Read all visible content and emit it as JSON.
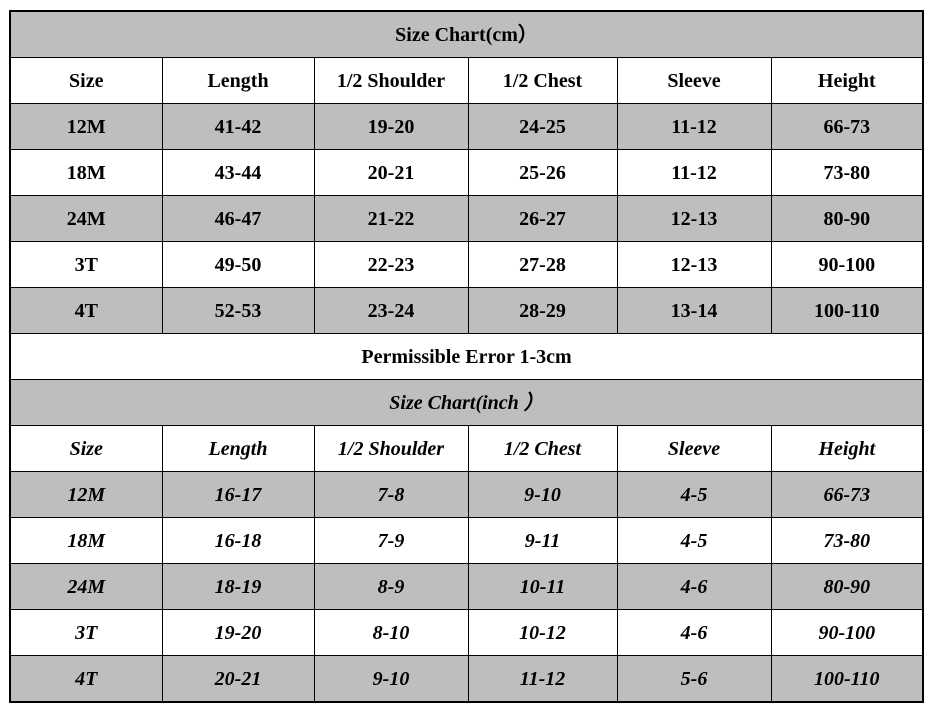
{
  "chart_data": {
    "type": "table",
    "title": "Size Chart",
    "sections": [
      {
        "id": "cm",
        "title": "Size Chart(cm）",
        "unit": "cm",
        "italic": false,
        "columns": [
          "Size",
          "Length",
          "1/2 Shoulder",
          "1/2 Chest",
          "Sleeve",
          "Height"
        ],
        "rows": [
          [
            "12M",
            "41-42",
            "19-20",
            "24-25",
            "11-12",
            "66-73"
          ],
          [
            "18M",
            "43-44",
            "20-21",
            "25-26",
            "11-12",
            "73-80"
          ],
          [
            "24M",
            "46-47",
            "21-22",
            "26-27",
            "12-13",
            "80-90"
          ],
          [
            "3T",
            "49-50",
            "22-23",
            "27-28",
            "12-13",
            "90-100"
          ],
          [
            "4T",
            "52-53",
            "23-24",
            "28-29",
            "13-14",
            "100-110"
          ]
        ]
      },
      {
        "id": "inch",
        "title": "Size Chart(inch ）",
        "unit": "inch",
        "italic": true,
        "columns": [
          "Size",
          "Length",
          "1/2 Shoulder",
          "1/2 Chest",
          "Sleeve",
          "Height"
        ],
        "rows": [
          [
            "12M",
            "16-17",
            "7-8",
            "9-10",
            "4-5",
            "66-73"
          ],
          [
            "18M",
            "16-18",
            "7-9",
            "9-11",
            "4-5",
            "73-80"
          ],
          [
            "24M",
            "18-19",
            "8-9",
            "10-11",
            "4-6",
            "80-90"
          ],
          [
            "3T",
            "19-20",
            "8-10",
            "10-12",
            "4-6",
            "90-100"
          ],
          [
            "4T",
            "20-21",
            "9-10",
            "11-12",
            "5-6",
            "100-110"
          ]
        ]
      }
    ],
    "note": "Permissible Error 1-3cm",
    "colors": {
      "row_gray": "#bebebe",
      "row_white": "#ffffff",
      "note_red": "#ee0000",
      "border": "#000000",
      "text": "#000000"
    }
  }
}
